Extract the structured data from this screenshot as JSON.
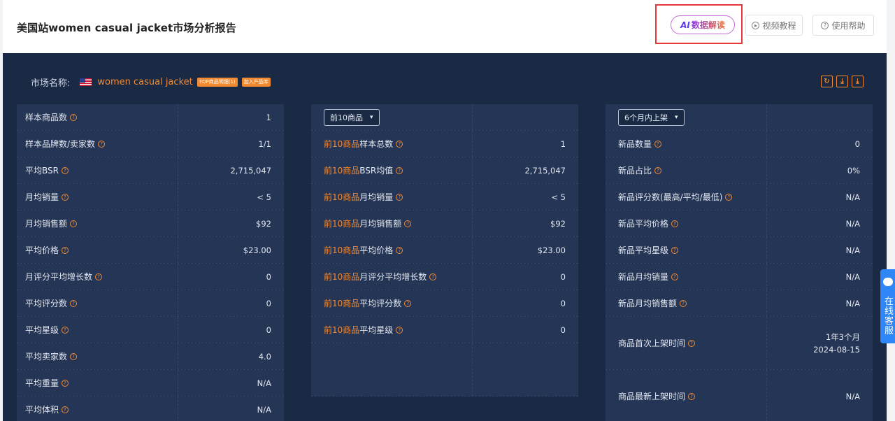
{
  "header": {
    "title": "美国站women casual jacket市场分析报告",
    "ai_button": {
      "mark": "AI",
      "label": "数据解读"
    },
    "video_button": "视频教程",
    "help_button": "使用帮助"
  },
  "market": {
    "label": "市场名称:",
    "name": "women casual jacket",
    "tag_top": "TOP商品明细(1)",
    "tag_add": "加入产品库"
  },
  "toolbar_icons": [
    "refresh-icon",
    "download-icon",
    "download-icon"
  ],
  "col1": {
    "rows": [
      {
        "label": "样本商品数",
        "value": "1"
      },
      {
        "label": "样本品牌数/卖家数",
        "value": "1/1"
      },
      {
        "label": "平均BSR",
        "value": "2,715,047"
      },
      {
        "label": "月均销量",
        "value": "< 5"
      },
      {
        "label": "月均销售额",
        "value": "$92"
      },
      {
        "label": "平均价格",
        "value": "$23.00"
      },
      {
        "label": "月评分平均增长数",
        "value": "0"
      },
      {
        "label": "平均评分数",
        "value": "0"
      },
      {
        "label": "平均星级",
        "value": "0"
      },
      {
        "label": "平均卖家数",
        "value": "4.0"
      },
      {
        "label": "平均重量",
        "value": "N/A"
      },
      {
        "label": "平均体积",
        "value": "N/A"
      }
    ]
  },
  "col2": {
    "select": "前10商品",
    "prefix": "前10商品",
    "rows": [
      {
        "label": "样本总数",
        "value": "1"
      },
      {
        "label": "BSR均值",
        "value": "2,715,047"
      },
      {
        "label": "月均销量",
        "value": "< 5"
      },
      {
        "label": "月均销售额",
        "value": "$92"
      },
      {
        "label": "平均价格",
        "value": "$23.00"
      },
      {
        "label": "月评分平均增长数",
        "value": "0"
      },
      {
        "label": "平均评分数",
        "value": "0"
      },
      {
        "label": "平均星级",
        "value": "0"
      }
    ]
  },
  "col3": {
    "select": "6个月内上架",
    "rows": [
      {
        "label": "新品数量",
        "value": "0"
      },
      {
        "label": "新品占比",
        "value": "0%"
      },
      {
        "label": "新品评分数(最高/平均/最低)",
        "value": "N/A"
      },
      {
        "label": "新品平均价格",
        "value": "N/A"
      },
      {
        "label": "新品平均星级",
        "value": "N/A"
      },
      {
        "label": "新品月均销量",
        "value": "N/A"
      },
      {
        "label": "新品月均销售额",
        "value": "N/A"
      }
    ],
    "first_listed": {
      "label": "商品首次上架时间",
      "value1": "1年3个月",
      "value2": "2024-08-15"
    },
    "latest_listed": {
      "label": "商品最新上架时间",
      "value": "N/A"
    }
  },
  "float_service": {
    "label": "在线客服"
  }
}
